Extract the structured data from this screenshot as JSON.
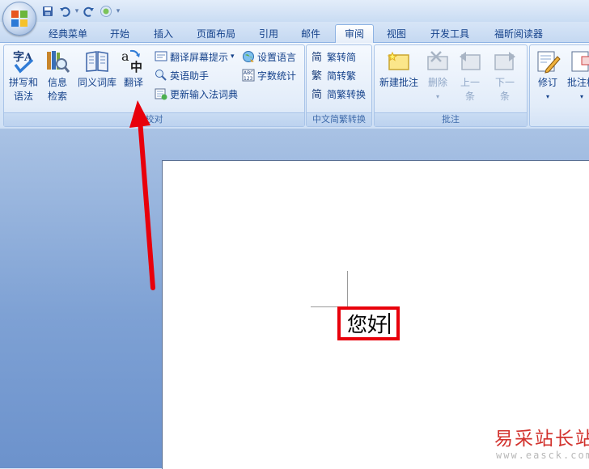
{
  "quick_access": {
    "items": [
      {
        "name": "save-icon"
      },
      {
        "name": "undo-icon"
      },
      {
        "name": "redo-icon"
      },
      {
        "name": "circle-icon"
      },
      {
        "name": "customize-icon"
      }
    ]
  },
  "tabs": [
    {
      "label": "经典菜单"
    },
    {
      "label": "开始"
    },
    {
      "label": "插入"
    },
    {
      "label": "页面布局"
    },
    {
      "label": "引用"
    },
    {
      "label": "邮件"
    },
    {
      "label": "审阅",
      "active": true
    },
    {
      "label": "视图"
    },
    {
      "label": "开发工具"
    },
    {
      "label": "福昕阅读器"
    }
  ],
  "ribbon": {
    "proofing": {
      "label": "校对",
      "spelling_line1": "拼写和",
      "spelling_line2": "语法",
      "research_line1": "信息",
      "research_line2": "检索",
      "thesaurus": "同义词库",
      "translate": "翻译",
      "translate_tips": "翻译屏幕提示",
      "english_assistant": "英语助手",
      "update_ime": "更新输入法词典",
      "set_language": "设置语言",
      "word_count": "字数统计"
    },
    "chinese_conversion": {
      "label": "中文简繁转换",
      "to_simplified": "繁转简",
      "to_traditional": "简转繁",
      "conversion": "简繁转换"
    },
    "comments": {
      "label": "批注",
      "new_comment": "新建批注",
      "delete": "删除",
      "previous_line1": "上一",
      "previous_line2": "条",
      "next_line1": "下一",
      "next_line2": "条"
    },
    "tracking": {
      "track_changes": "修订",
      "comment_box": "批注框"
    }
  },
  "document": {
    "text": "您好"
  },
  "watermark": {
    "site": "易采站长站",
    "url": "www.easck.com"
  },
  "colors": {
    "highlight_box": "#e8000b",
    "arrow": "#e8000b"
  }
}
